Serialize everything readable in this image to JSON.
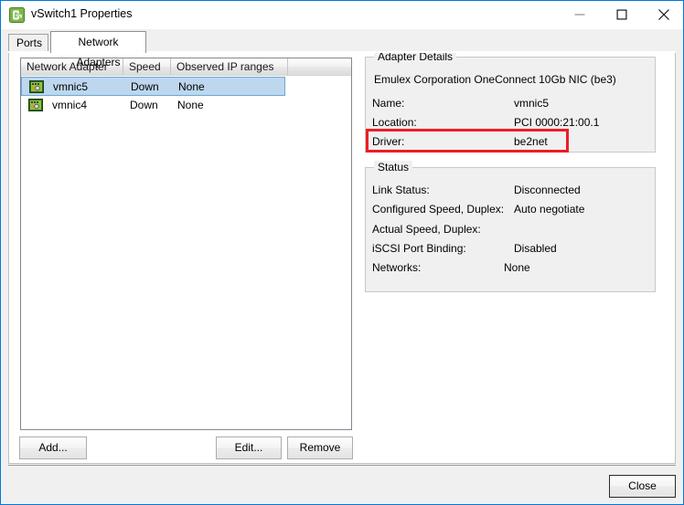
{
  "window": {
    "title": "vSwitch1 Properties",
    "icon": "vswitch-properties-icon",
    "controls": {
      "minimize": "minimize-icon",
      "maximize": "maximize-icon",
      "close": "close-icon"
    }
  },
  "tabs": [
    {
      "label": "Ports",
      "active": false
    },
    {
      "label": "Network Adapters",
      "active": true
    }
  ],
  "adapter_list": {
    "columns": [
      "Network Adapter",
      "Speed",
      "Observed IP ranges",
      ""
    ],
    "rows": [
      {
        "name": "vmnic5",
        "speed": "Down",
        "ip_ranges": "None",
        "selected": true,
        "icon": "network-adapter-icon"
      },
      {
        "name": "vmnic4",
        "speed": "Down",
        "ip_ranges": "None",
        "selected": false,
        "icon": "network-adapter-icon"
      }
    ]
  },
  "adapter_details": {
    "legend": "Adapter Details",
    "device": "Emulex Corporation OneConnect 10Gb NIC (be3)",
    "fields": [
      {
        "label": "Name:",
        "value": "vmnic5"
      },
      {
        "label": "Location:",
        "value": "PCI 0000:21:00.1"
      },
      {
        "label": "Driver:",
        "value": "be2net"
      }
    ]
  },
  "status": {
    "legend": "Status",
    "fields": [
      {
        "label": "Link Status:",
        "value": "Disconnected"
      },
      {
        "label": "Configured Speed, Duplex:",
        "value": "Auto negotiate"
      },
      {
        "label": "Actual Speed, Duplex:",
        "value": ""
      },
      {
        "label": "iSCSI Port Binding:",
        "value": "Disabled"
      },
      {
        "label": "Networks:",
        "value": "None"
      }
    ]
  },
  "buttons": {
    "add": "Add...",
    "edit": "Edit...",
    "remove": "Remove",
    "close": "Close"
  },
  "annotation": {
    "highlight_color": "#ee1c25",
    "highlight_target": "Driver:"
  }
}
